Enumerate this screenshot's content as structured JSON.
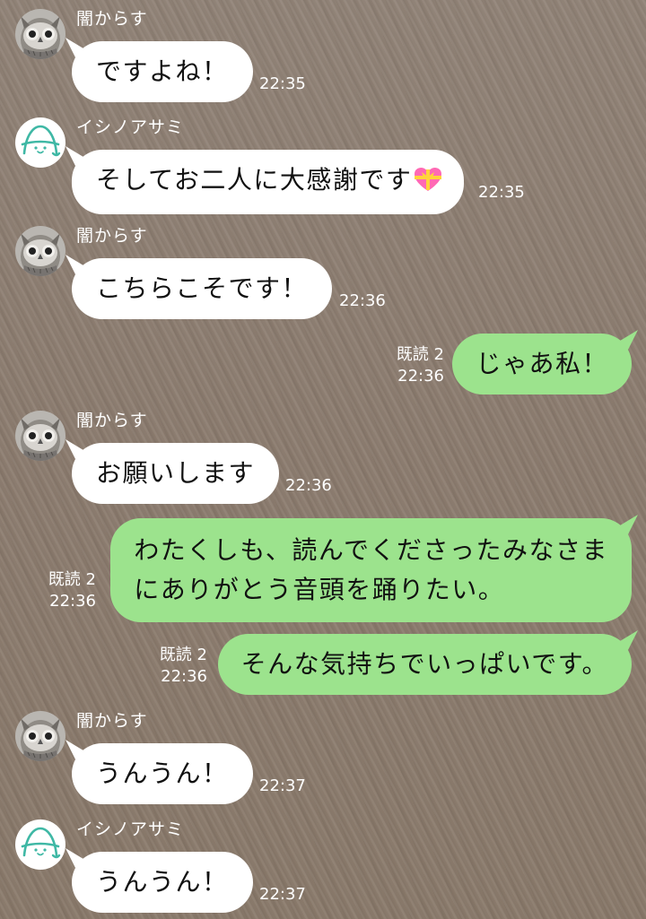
{
  "messages": [
    {
      "direction": "in",
      "sender": "闇からす",
      "avatar": "owl-avatar",
      "text": "ですよね！",
      "time": "22:35"
    },
    {
      "direction": "in",
      "sender": "イシノアサミ",
      "avatar": "ishino-logo-avatar",
      "text": "そしてお二人に大感謝です",
      "emoji": "heart-with-ribbon-icon",
      "time": "22:35"
    },
    {
      "direction": "in",
      "sender": "闇からす",
      "avatar": "owl-avatar",
      "text": "こちらこそです！",
      "time": "22:36"
    },
    {
      "direction": "out",
      "read": "既読 2",
      "text": "じゃあ私！",
      "time": "22:36"
    },
    {
      "direction": "in",
      "sender": "闇からす",
      "avatar": "owl-avatar",
      "text": "お願いします",
      "time": "22:36"
    },
    {
      "direction": "out",
      "read": "既読 2",
      "text_line1": "わたくしも、読んでくださったみなさま",
      "text_line2": "にありがとう音頭を踊りたい。",
      "time": "22:36"
    },
    {
      "direction": "out",
      "read": "既読 2",
      "text": "そんな気持ちでいっぱいです。",
      "time": "22:36"
    },
    {
      "direction": "in",
      "sender": "闇からす",
      "avatar": "owl-avatar",
      "text": "うんうん！",
      "time": "22:37"
    },
    {
      "direction": "in",
      "sender": "イシノアサミ",
      "avatar": "ishino-logo-avatar",
      "text": "うんうん！",
      "time": "22:37"
    }
  ],
  "colors": {
    "outgoing_bubble": "#9ce38d",
    "incoming_bubble": "#ffffff",
    "wallpaper": "#8c7d70",
    "logo_teal": "#3fb8a5"
  }
}
